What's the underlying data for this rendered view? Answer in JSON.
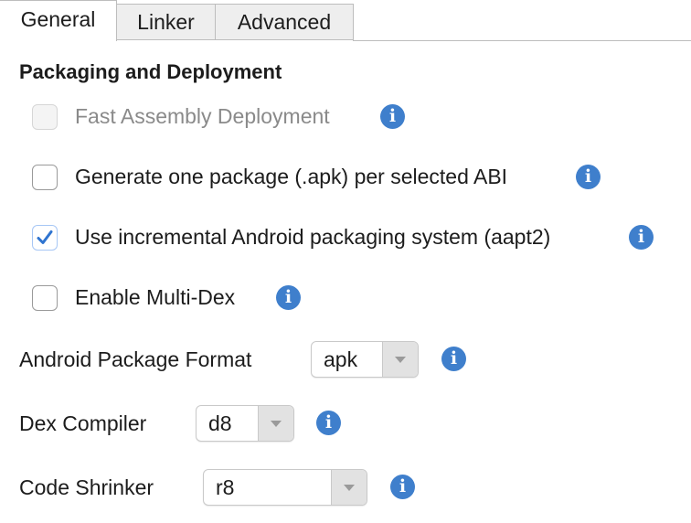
{
  "tabs": [
    {
      "label": "General",
      "active": true
    },
    {
      "label": "Linker",
      "active": false
    },
    {
      "label": "Advanced",
      "active": false
    }
  ],
  "section": {
    "title": "Packaging and Deployment"
  },
  "options": [
    {
      "label": "Fast Assembly Deployment",
      "checked": false,
      "disabled": true
    },
    {
      "label": "Generate one package (.apk) per selected ABI",
      "checked": false,
      "disabled": false
    },
    {
      "label": "Use incremental Android packaging system (aapt2)",
      "checked": true,
      "disabled": false
    },
    {
      "label": "Enable Multi-Dex",
      "checked": false,
      "disabled": false
    }
  ],
  "fields": [
    {
      "label": "Android Package Format",
      "value": "apk"
    },
    {
      "label": "Dex Compiler",
      "value": "d8"
    },
    {
      "label": "Code Shrinker",
      "value": "r8"
    }
  ],
  "icons": {
    "info": "info-icon",
    "check": "checkmark-icon",
    "dropdown": "chevron-down-icon"
  },
  "colors": {
    "accent": "#3f7fcc",
    "check": "#2f74d0"
  },
  "info_glyph": "i"
}
